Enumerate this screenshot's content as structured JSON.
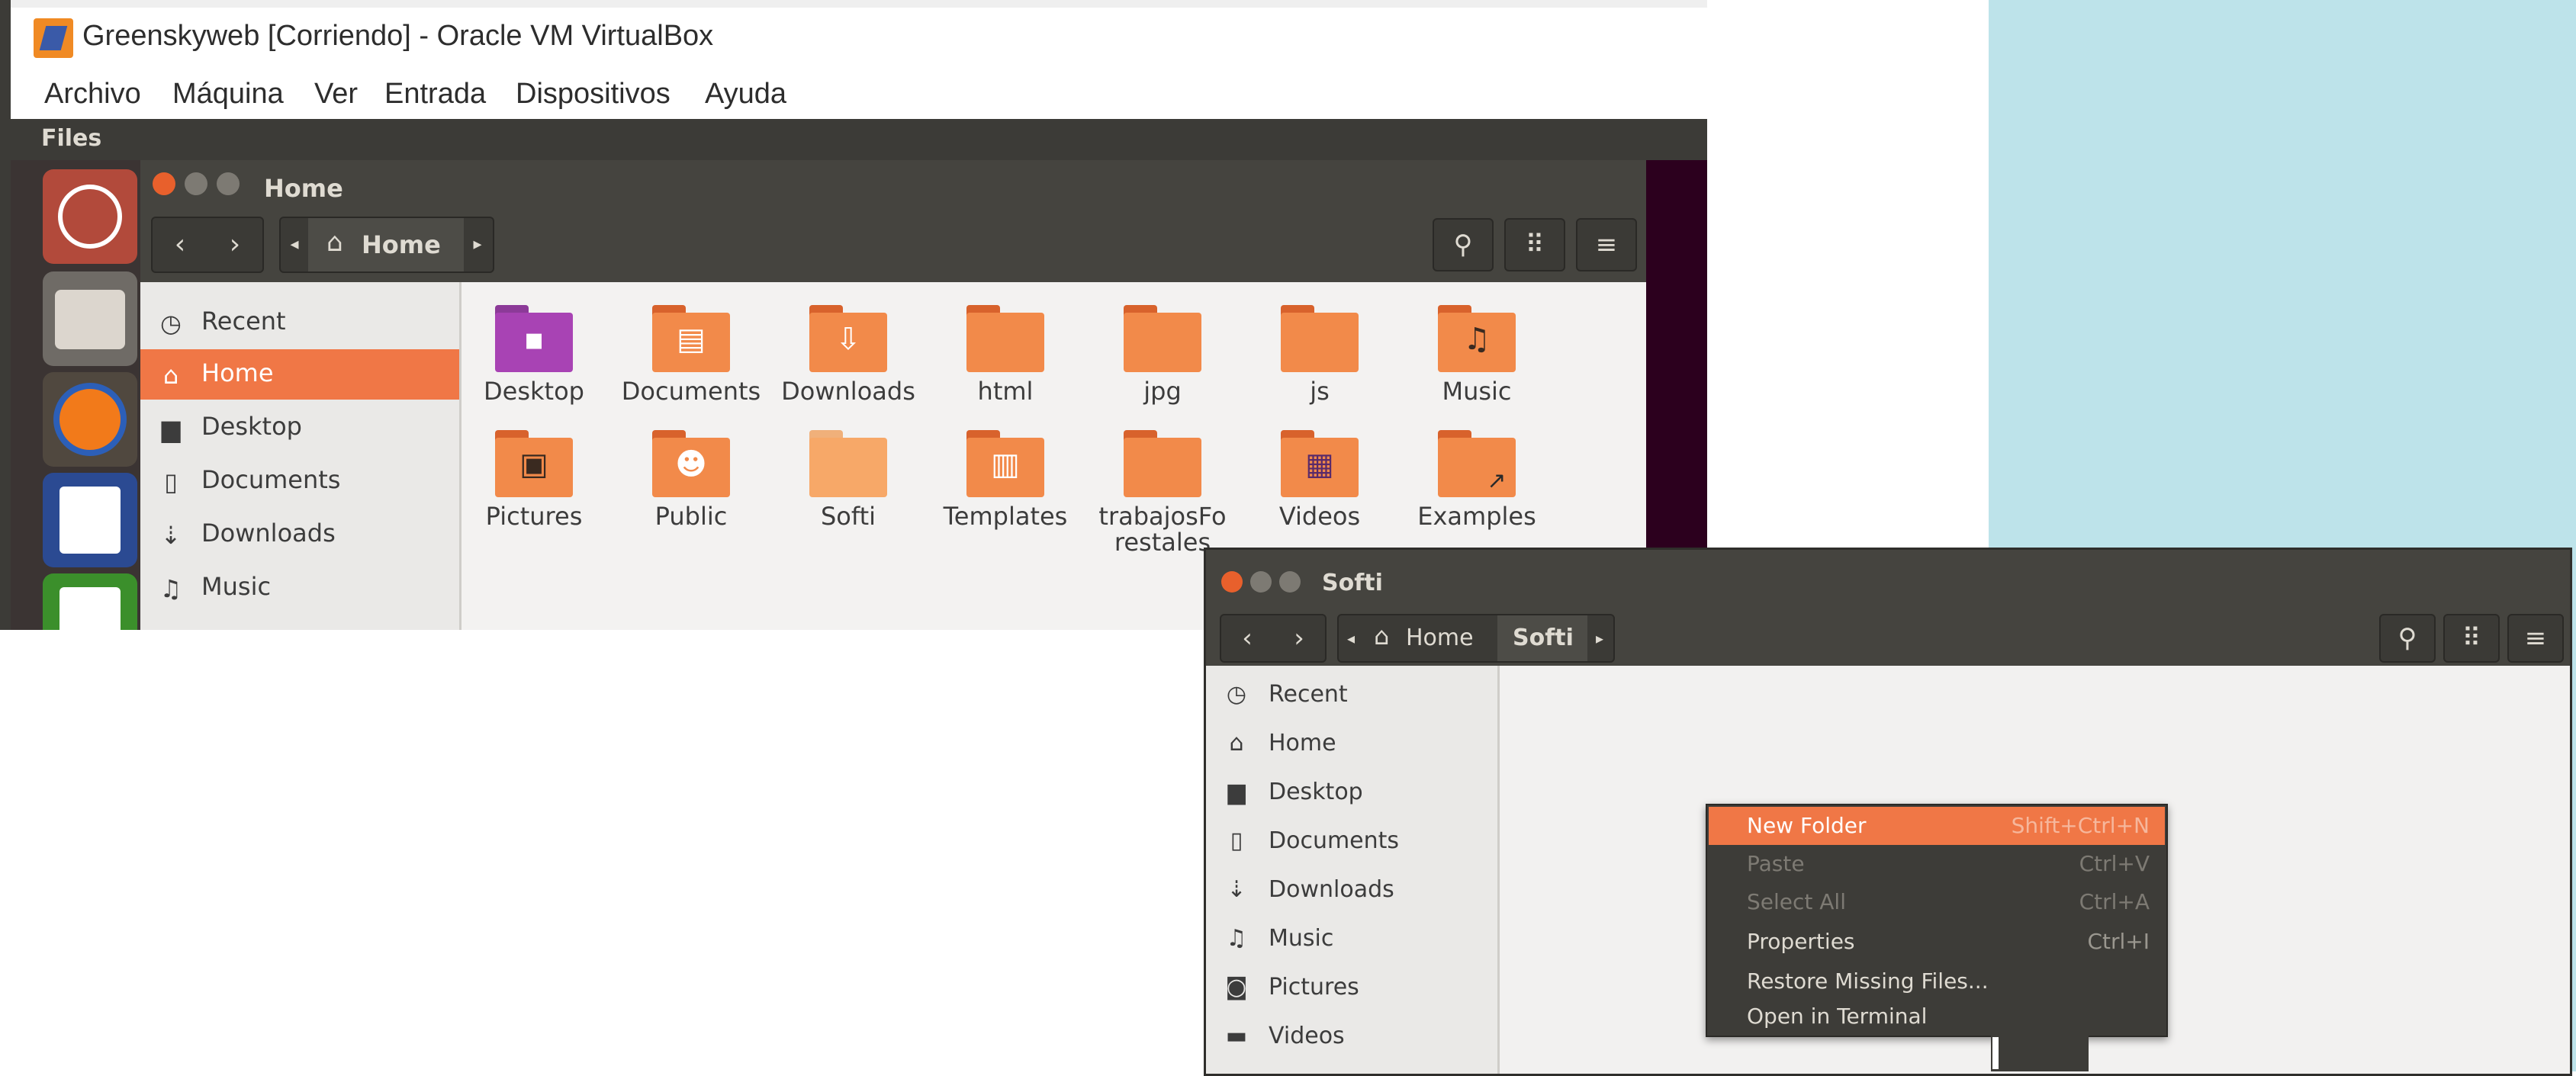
{
  "vbox": {
    "title": "Greenskyweb [Corriendo] - Oracle VM VirtualBox",
    "menu": [
      "Archivo",
      "Máquina",
      "Ver",
      "Entrada",
      "Dispositivos",
      "Ayuda"
    ]
  },
  "ubuntu": {
    "topbar_label": "Files",
    "launcher": [
      "ubuntu-dash-icon",
      "files-icon",
      "firefox-icon",
      "writer-icon",
      "calc-icon"
    ]
  },
  "home_window": {
    "title": "Home",
    "breadcrumb": [
      "Home"
    ],
    "sidebar": [
      "Recent",
      "Home",
      "Desktop",
      "Documents",
      "Downloads",
      "Music"
    ],
    "active_sidebar": "Home",
    "folders": [
      {
        "label": "Desktop",
        "icon": "desktop"
      },
      {
        "label": "Documents",
        "icon": "documents"
      },
      {
        "label": "Downloads",
        "icon": "downloads"
      },
      {
        "label": "html",
        "icon": "folder"
      },
      {
        "label": "jpg",
        "icon": "folder"
      },
      {
        "label": "js",
        "icon": "folder"
      },
      {
        "label": "Music",
        "icon": "music"
      },
      {
        "label": "Pictures",
        "icon": "pictures"
      },
      {
        "label": "Public",
        "icon": "public"
      },
      {
        "label": "Softi",
        "icon": "folder-open"
      },
      {
        "label": "Templates",
        "icon": "templates"
      },
      {
        "label": "trabajosFo restales",
        "icon": "folder"
      },
      {
        "label": "Videos",
        "icon": "videos"
      },
      {
        "label": "Examples",
        "icon": "examples"
      }
    ]
  },
  "softi_window": {
    "title": "Softi",
    "breadcrumb": [
      "Home",
      "Softi"
    ],
    "sidebar": [
      "Recent",
      "Home",
      "Desktop",
      "Documents",
      "Downloads",
      "Music",
      "Pictures",
      "Videos"
    ]
  },
  "context_menu": {
    "items": [
      {
        "label": "New Folder",
        "accel": "Shift+Ctrl+N",
        "state": "highlighted"
      },
      {
        "label": "Paste",
        "accel": "Ctrl+V",
        "state": "disabled"
      },
      {
        "label": "Select All",
        "accel": "Ctrl+A",
        "state": "disabled"
      },
      {
        "label": "Properties",
        "accel": "Ctrl+I",
        "state": "enabled"
      },
      {
        "label": "Restore Missing Files...",
        "accel": "",
        "state": "enabled"
      },
      {
        "label": "Open in Terminal",
        "accel": "",
        "state": "enabled"
      }
    ]
  },
  "colors": {
    "accent": "#f07746",
    "header": "#45443f",
    "launcher": "#3b3433",
    "wallpaper": "#2c001e",
    "panel_blue": "#bde3ea"
  }
}
